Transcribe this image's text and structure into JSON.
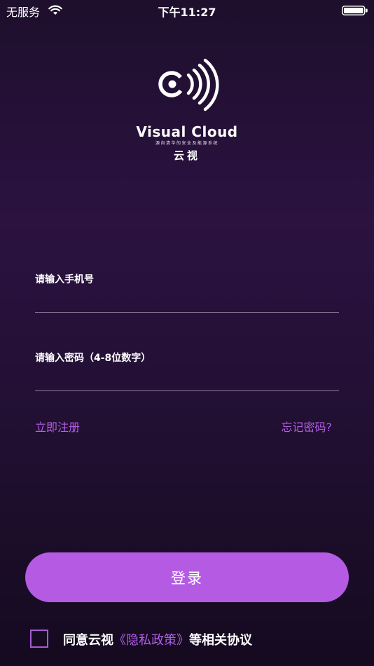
{
  "status_bar": {
    "carrier": "无服务",
    "time": "下午11:27",
    "wifi_icon": "wifi-icon",
    "battery_icon": "battery-icon"
  },
  "logo": {
    "icon": "visual-cloud-logo-icon",
    "name": "Visual Cloud",
    "tagline": "源自清华的安全及能源系统",
    "cn_name": "云视"
  },
  "form": {
    "phone_label": "请输入手机号",
    "phone_value": "",
    "password_label": "请输入密码（4-8位数字）",
    "password_value": ""
  },
  "links": {
    "register": "立即注册",
    "forgot_password": "忘记密码?"
  },
  "login_button": "登录",
  "agreement": {
    "checked": false,
    "prefix": "同意云视",
    "policy_link": "《隐私政策》",
    "suffix": "等相关协议"
  },
  "colors": {
    "accent": "#b55be3",
    "link": "#b25ee6",
    "background_top": "#1e0f2c",
    "background_mid": "#2b1240",
    "background_bottom": "#150a20",
    "divider": "#8c7c98"
  }
}
